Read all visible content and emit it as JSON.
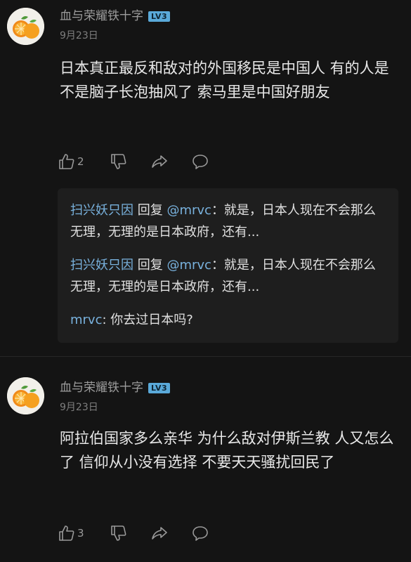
{
  "comments": [
    {
      "username": "血与荣耀铁十字",
      "level": "LV3",
      "date": "9月23日",
      "text": "日本真正最反和敌对的外国移民是中国人 有的人是不是脑子长泡抽风了 索马里是中国好朋友",
      "likes": "2",
      "replies": [
        {
          "author": "扫兴妖只因",
          "verb": " 回复 ",
          "mention": "@mrvc",
          "text": "：就是，日本人现在不会那么无理，无理的是日本政府，还有..."
        },
        {
          "author": "扫兴妖只因",
          "verb": " 回复 ",
          "mention": "@mrvc",
          "text": "：就是，日本人现在不会那么无理，无理的是日本政府，还有..."
        },
        {
          "author": "mrvc",
          "text": ": 你去过日本吗?"
        }
      ]
    },
    {
      "username": "血与荣耀铁十字",
      "level": "LV3",
      "date": "9月23日",
      "text": "阿拉伯国家多么亲华 为什么敌对伊斯兰教 人又怎么了 信仰从小没有选择 不要天天骚扰回民了",
      "likes": "3"
    }
  ],
  "icons": {
    "like": "thumbs-up-icon",
    "dislike": "thumbs-down-icon",
    "share": "share-arrow-icon",
    "reply": "comment-bubble-icon",
    "avatar": "orange-fruit-avatar"
  },
  "colors": {
    "background": "#141414",
    "link": "#79b2de",
    "badge": "#5aa9d9",
    "reply_panel": "#1e1e1e"
  }
}
